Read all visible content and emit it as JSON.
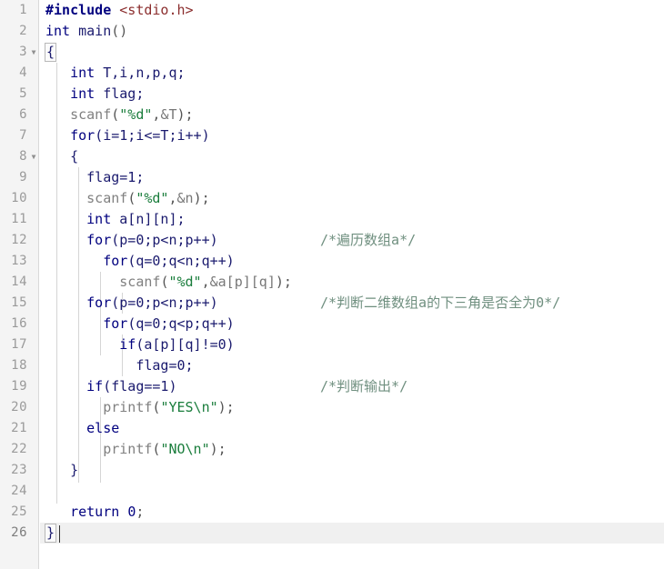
{
  "editor": {
    "language": "C",
    "gutter_background": "#f4f4f4",
    "code_background": "#ffffff",
    "active_line_background": "#f0f0f0",
    "active_line": 26,
    "total_lines": 26,
    "fold_marker_glyph": "▼",
    "fold_lines": [
      3,
      8
    ],
    "colors": {
      "keyword": "#00007f",
      "preprocessor": "#00007f",
      "header": "#8b2e2e",
      "string": "#1a7d3c",
      "comment": "#6f8f7f",
      "function": "#808080",
      "identifier": "#1a1a6e",
      "line_number": "#9a9a9a"
    }
  },
  "line_numbers": [
    "1",
    "2",
    "3",
    "4",
    "5",
    "6",
    "7",
    "8",
    "9",
    "10",
    "11",
    "12",
    "13",
    "14",
    "15",
    "16",
    "17",
    "18",
    "19",
    "20",
    "21",
    "22",
    "23",
    "24",
    "25",
    "26"
  ],
  "code_lines": [
    {
      "n": 1,
      "indent": 0,
      "text": "#include <stdio.h>"
    },
    {
      "n": 2,
      "indent": 0,
      "text": "int main()"
    },
    {
      "n": 3,
      "indent": 0,
      "text": "{"
    },
    {
      "n": 4,
      "indent": 1,
      "text": "int T,i,n,p,q;"
    },
    {
      "n": 5,
      "indent": 1,
      "text": "int flag;"
    },
    {
      "n": 6,
      "indent": 1,
      "text": "scanf(\"%d\",&T);"
    },
    {
      "n": 7,
      "indent": 1,
      "text": "for(i=1;i<=T;i++)"
    },
    {
      "n": 8,
      "indent": 1,
      "text": "{"
    },
    {
      "n": 9,
      "indent": 2,
      "text": "flag=1;"
    },
    {
      "n": 10,
      "indent": 2,
      "text": "scanf(\"%d\",&n);"
    },
    {
      "n": 11,
      "indent": 2,
      "text": "int a[n][n];"
    },
    {
      "n": 12,
      "indent": 2,
      "text": "for(p=0;p<n;p++)"
    },
    {
      "n": 13,
      "indent": 3,
      "text": "for(q=0;q<n;q++)"
    },
    {
      "n": 14,
      "indent": 4,
      "text": "scanf(\"%d\",&a[p][q]);"
    },
    {
      "n": 15,
      "indent": 2,
      "text": "for(p=0;p<n;p++)"
    },
    {
      "n": 16,
      "indent": 3,
      "text": "for(q=0;q<p;q++)"
    },
    {
      "n": 17,
      "indent": 4,
      "text": "if(a[p][q]!=0)"
    },
    {
      "n": 18,
      "indent": 5,
      "text": "flag=0;"
    },
    {
      "n": 19,
      "indent": 2,
      "text": "if(flag==1)"
    },
    {
      "n": 20,
      "indent": 3,
      "text": "printf(\"YES\\n\");"
    },
    {
      "n": 21,
      "indent": 2,
      "text": "else"
    },
    {
      "n": 22,
      "indent": 3,
      "text": "printf(\"NO\\n\");"
    },
    {
      "n": 23,
      "indent": 1,
      "text": "}"
    },
    {
      "n": 24,
      "indent": 0,
      "text": ""
    },
    {
      "n": 25,
      "indent": 1,
      "text": "return 0;"
    },
    {
      "n": 26,
      "indent": 0,
      "text": "}"
    }
  ],
  "comments": [
    {
      "line": 12,
      "text": "/*遍历数组a*/"
    },
    {
      "line": 15,
      "text": "/*判断二维数组a的下三角是否全为0*/"
    },
    {
      "line": 19,
      "text": "/*判断输出*/"
    }
  ],
  "tokens": {
    "l1": {
      "pre": "#include",
      "sp": " ",
      "hdr": "<stdio.h>"
    },
    "l2": {
      "kw": "int",
      "sp": " ",
      "id": "main",
      "punc": "()"
    },
    "l3": {
      "brace": "{"
    },
    "l4": {
      "kw": "int",
      "sp": " ",
      "rest": "T,i,n,p,q;"
    },
    "l5": {
      "kw": "int",
      "sp": " ",
      "rest": "flag;"
    },
    "l6": {
      "fn": "scanf",
      "o": "(",
      "str": "\"%d\"",
      "c": ",",
      "amp": "&T",
      "e": ");"
    },
    "l7": {
      "kw": "for",
      "rest": "(i=1;i<=T;i++)"
    },
    "l8": {
      "brace": "{"
    },
    "l9": {
      "rest": "flag=1;"
    },
    "l10": {
      "fn": "scanf",
      "o": "(",
      "str": "\"%d\"",
      "c": ",",
      "amp": "&n",
      "e": ");"
    },
    "l11": {
      "kw": "int",
      "sp": " ",
      "rest": "a[n][n];"
    },
    "l12": {
      "kw": "for",
      "rest": "(p=0;p<n;p++)"
    },
    "l13": {
      "kw": "for",
      "rest": "(q=0;q<n;q++)"
    },
    "l14": {
      "fn": "scanf",
      "o": "(",
      "str": "\"%d\"",
      "c": ",",
      "amp": "&a[p][q]",
      "e": ");"
    },
    "l15": {
      "kw": "for",
      "rest": "(p=0;p<n;p++)"
    },
    "l16": {
      "kw": "for",
      "rest": "(q=0;q<p;q++)"
    },
    "l17": {
      "kw": "if",
      "rest": "(a[p][q]!=0)"
    },
    "l18": {
      "rest": "flag=0;"
    },
    "l19": {
      "kw": "if",
      "rest": "(flag==1)"
    },
    "l20": {
      "fn": "printf",
      "o": "(",
      "str": "\"YES\\n\"",
      "e": ");"
    },
    "l21": {
      "kw": "else"
    },
    "l22": {
      "fn": "printf",
      "o": "(",
      "str": "\"NO\\n\"",
      "e": ");"
    },
    "l23": {
      "brace": "}"
    },
    "l25": {
      "kw": "return",
      "sp": " ",
      "num": "0",
      "e": ";"
    },
    "l26": {
      "brace": "}"
    }
  }
}
